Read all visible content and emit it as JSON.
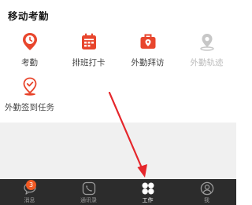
{
  "section": {
    "title": "移动考勤"
  },
  "grid": [
    {
      "label": "考勤",
      "icon": "clock-pin-icon",
      "enabled": true
    },
    {
      "label": "排班打卡",
      "icon": "calendar-icon",
      "enabled": true
    },
    {
      "label": "外勤拜访",
      "icon": "briefcase-pin-icon",
      "enabled": true
    },
    {
      "label": "外勤轨迹",
      "icon": "location-pin-icon",
      "enabled": false
    },
    {
      "label": "外勤签到任务",
      "icon": "location-check-icon",
      "enabled": true
    }
  ],
  "tabbar": {
    "tabs": [
      {
        "label": "消息",
        "icon": "chat-icon",
        "badge": "3"
      },
      {
        "label": "通讯录",
        "icon": "phone-icon"
      },
      {
        "label": "工作",
        "icon": "grid-icon",
        "active": true
      },
      {
        "label": "我",
        "icon": "user-icon"
      }
    ]
  },
  "colors": {
    "accent": "#e8462d",
    "disabled": "#bbbbbb",
    "tabbar_bg": "#2c2c2c",
    "badge": "#f15a24"
  }
}
